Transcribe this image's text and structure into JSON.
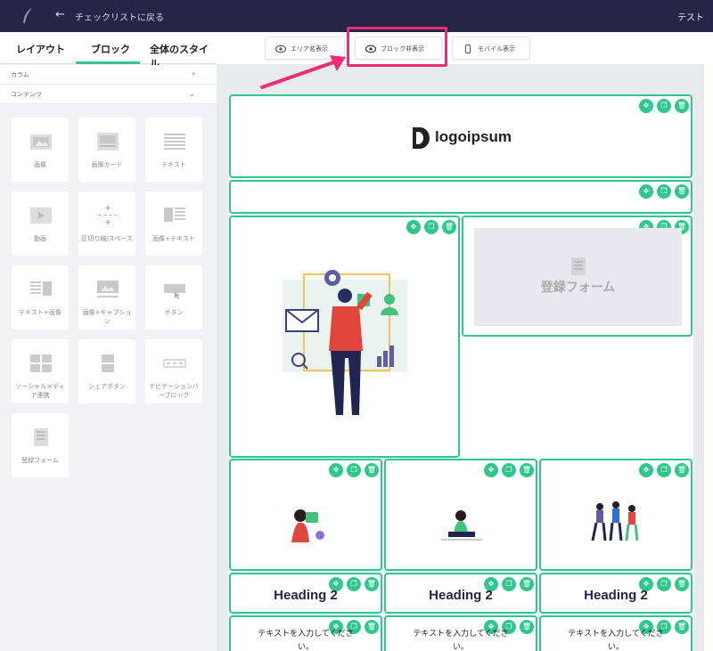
{
  "topbar": {
    "back_label": "チェックリストに戻る",
    "user_label": "テスト"
  },
  "tabs": [
    {
      "label": "レイアウト"
    },
    {
      "label": "ブロック"
    },
    {
      "label": "全体のスタイル"
    }
  ],
  "sections": {
    "column_label": "カラム",
    "content_label": "コンテンツ"
  },
  "tiles": [
    {
      "label": "画像",
      "icon": "image-icon"
    },
    {
      "label": "画像カード",
      "icon": "image-card-icon"
    },
    {
      "label": "テキスト",
      "icon": "text-icon"
    },
    {
      "label": "動画",
      "icon": "video-icon"
    },
    {
      "label": "区切り線/スペース",
      "icon": "divider-icon"
    },
    {
      "label": "画像+テキスト",
      "icon": "image-text-icon"
    },
    {
      "label": "テキスト+画像",
      "icon": "text-image-icon"
    },
    {
      "label": "画像+キャプション",
      "icon": "image-caption-icon"
    },
    {
      "label": "ボタン",
      "icon": "button-icon"
    },
    {
      "label": "ソーシャルメディア連携",
      "icon": "social-icon"
    },
    {
      "label": "シェアボタン",
      "icon": "share-icon"
    },
    {
      "label": "ナビゲーションバーブロック",
      "icon": "navbar-icon"
    },
    {
      "label": "登録フォーム",
      "icon": "form-icon"
    }
  ],
  "toolbar": {
    "area_label": "エリア名表示",
    "block_hide_label": "ブロック非表示",
    "mobile_label": "モバイル表示"
  },
  "canvas": {
    "logo_text": "logoipsum",
    "form_placeholder": "登録フォーム",
    "headings": [
      "Heading 2",
      "Heading 2",
      "Heading 2"
    ],
    "paragraphs": [
      "テキストを入力してください。",
      "テキストを入力してください。",
      "テキストを入力してください。"
    ]
  },
  "colors": {
    "accent": "#2fc78b",
    "topbar": "#262548",
    "highlight": "#ea2d75"
  }
}
